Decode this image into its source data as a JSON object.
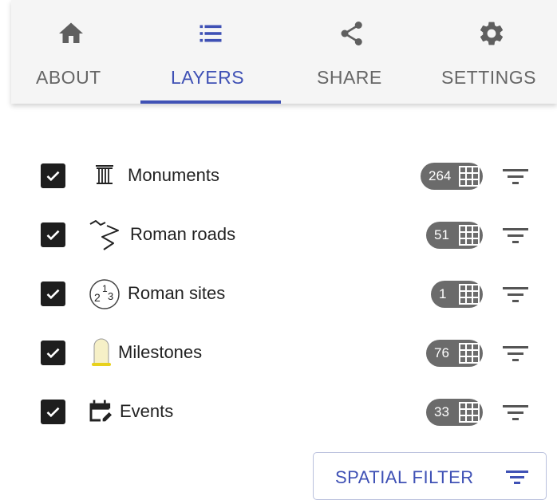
{
  "tabs": [
    {
      "label": "ABOUT",
      "icon": "home-icon",
      "active": false
    },
    {
      "label": "LAYERS",
      "icon": "list-icon",
      "active": true
    },
    {
      "label": "SHARE",
      "icon": "share-icon",
      "active": false
    },
    {
      "label": "SETTINGS",
      "icon": "gear-icon",
      "active": false
    }
  ],
  "layers": [
    {
      "name": "Monuments",
      "icon": "column-icon",
      "count": "264",
      "checked": true
    },
    {
      "name": "Roman roads",
      "icon": "road-icon",
      "count": "51",
      "checked": true
    },
    {
      "name": "Roman sites",
      "icon": "numbered-circle-icon",
      "count": "1",
      "checked": true
    },
    {
      "name": "Milestones",
      "icon": "milestone-icon",
      "count": "76",
      "checked": true
    },
    {
      "name": "Events",
      "icon": "calendar-edit-icon",
      "count": "33",
      "checked": true
    }
  ],
  "spatial_filter": {
    "label": "SPATIAL FILTER"
  },
  "colors": {
    "accent": "#3f51b5",
    "badge": "#6b6b6b",
    "checkbox": "#1e1e1e",
    "milestone": "#f2e27a"
  }
}
